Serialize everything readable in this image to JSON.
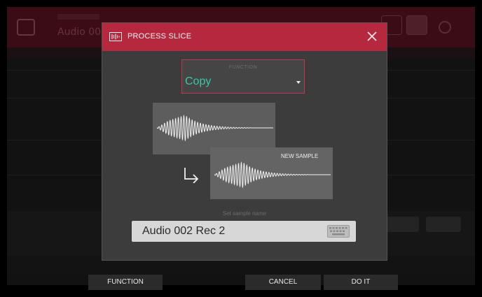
{
  "dialog": {
    "title": "PROCESS SLICE",
    "function_label": "FUNCTION",
    "function_value": "Copy",
    "new_sample_label": "NEW SAMPLE",
    "sample_name_label": "Set sample name",
    "sample_name_value": "Audio 002 Rec 2"
  },
  "footer": {
    "function_label": "FUNCTION",
    "cancel_label": "CANCEL",
    "doit_label": "DO IT"
  },
  "background": {
    "title": "Audio 00"
  },
  "colors": {
    "accent": "#b5283e",
    "function_value": "#3cc7a7",
    "dialog_bg": "#3c3c3c"
  },
  "icons": {
    "dialog_icon": "waveform-icon",
    "close": "close-icon",
    "arrow": "arrow-down-right-icon",
    "keyboard": "keyboard-icon",
    "dropdown": "caret-down-icon"
  }
}
